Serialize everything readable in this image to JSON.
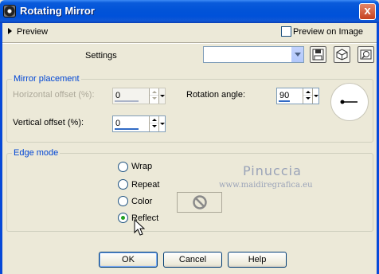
{
  "window": {
    "title": "Rotating Mirror",
    "close_symbol": "x"
  },
  "preview": {
    "label": "Preview",
    "preview_on_image_label": "Preview on Image",
    "preview_on_image_checked": false
  },
  "settings": {
    "label": "Settings",
    "value": ""
  },
  "mirror_placement": {
    "legend": "Mirror placement",
    "horizontal_offset": {
      "label": "Horizontal offset (%):",
      "value": "0",
      "enabled": false
    },
    "vertical_offset": {
      "label": "Vertical offset (%):",
      "value": "0",
      "enabled": true
    },
    "rotation_angle": {
      "label": "Rotation angle:",
      "value": "90"
    }
  },
  "edge_mode": {
    "legend": "Edge mode",
    "options": [
      {
        "label": "Wrap",
        "checked": false
      },
      {
        "label": "Repeat",
        "checked": false
      },
      {
        "label": "Color",
        "checked": false
      },
      {
        "label": "Reflect",
        "checked": true
      }
    ]
  },
  "watermark": {
    "name": "Pinuccia",
    "url": "www.maidiregrafica.eu"
  },
  "buttons": {
    "ok": "OK",
    "cancel": "Cancel",
    "help": "Help"
  },
  "colors": {
    "titlebar": "#0254d8",
    "legend": "#0046d5",
    "face": "#ece9d8"
  }
}
